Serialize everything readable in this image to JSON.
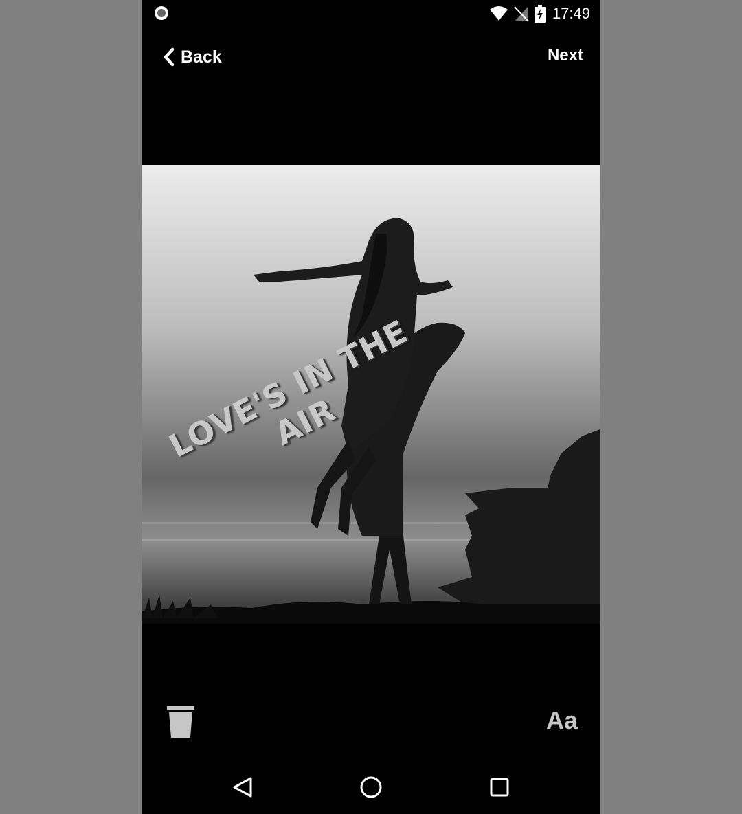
{
  "status_bar": {
    "time": "17:49",
    "icons": [
      "record-dot-icon",
      "wifi-icon",
      "no-sim-icon",
      "battery-charging-icon"
    ]
  },
  "top_bar": {
    "back_label": "Back",
    "next_label": "Next"
  },
  "photo": {
    "description_icon": "couple-silhouette-image"
  },
  "caption": {
    "text": "LOVE'S IN THE AIR"
  },
  "bottom_tools": {
    "text_label": "Aa",
    "icons": [
      "trash-icon"
    ]
  },
  "nav_bar": {
    "icons": [
      "back-triangle-icon",
      "home-circle-icon",
      "recents-square-icon"
    ]
  },
  "colors": {
    "background": "#808080",
    "screen": "#000000",
    "caption": "#c8c8c8"
  }
}
